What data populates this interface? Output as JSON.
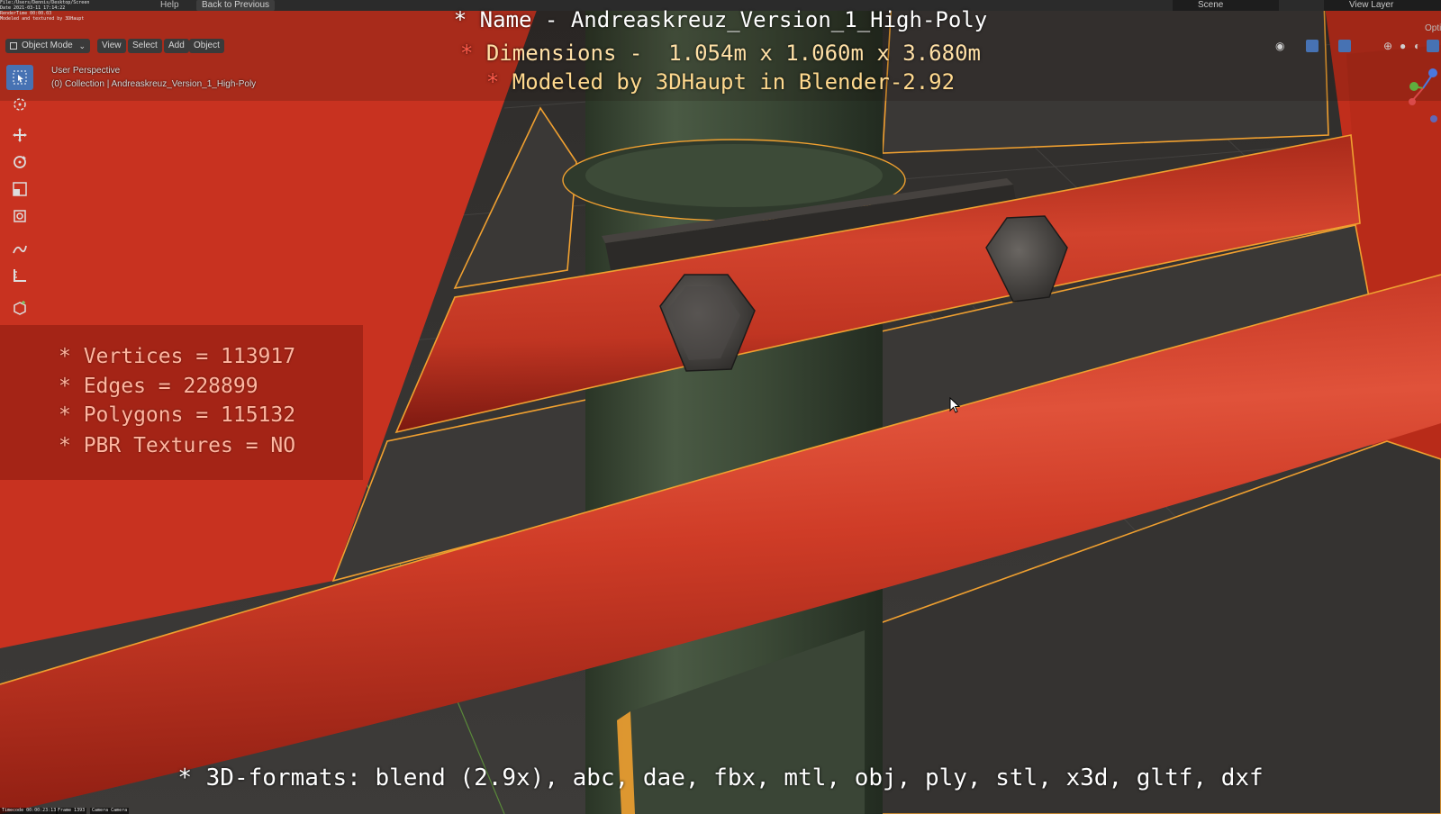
{
  "topbar": {
    "menu_items": [
      "Help"
    ],
    "back_button": "Back to Previous",
    "scene": "Scene",
    "view_layer": "View Layer",
    "options": "Opti"
  },
  "viewport_header": {
    "mode": "Object Mode",
    "menus": [
      "View",
      "Select",
      "Add",
      "Object"
    ]
  },
  "viewport_info": {
    "perspective": "User Perspective",
    "collection": "(0) Collection | Andreaskreuz_Version_1_High-Poly"
  },
  "overlay": {
    "name_line": "* Name - Andreaskreuz_Version_1_High-Poly",
    "dimensions_star": "*",
    "dimensions_text": " Dimensions -  1.054m x 1.060m x 3.680m",
    "modeled_star": "*",
    "modeled_text": " Modeled by 3DHaupt in Blender-2.92",
    "stats": [
      "* Vertices = 113917",
      "* Edges = 228899",
      "* Polygons = 115132",
      "* PBR Textures = NO"
    ],
    "formats": "* 3D-formats: blend (2.9x), abc, dae, fbx, mtl, obj, ply, stl, x3d, gltf, dxf"
  },
  "icons": {
    "toolbar": [
      "select-box-icon",
      "cursor-icon",
      "move-icon",
      "rotate-icon",
      "scale-icon",
      "transform-icon",
      "annotate-icon",
      "measure-icon",
      "add-cube-icon"
    ]
  },
  "colors": {
    "pipe_red": "#c83220",
    "selection_outline": "#f0a030",
    "active_tool": "#4772b3",
    "floor": "#3a3836"
  }
}
